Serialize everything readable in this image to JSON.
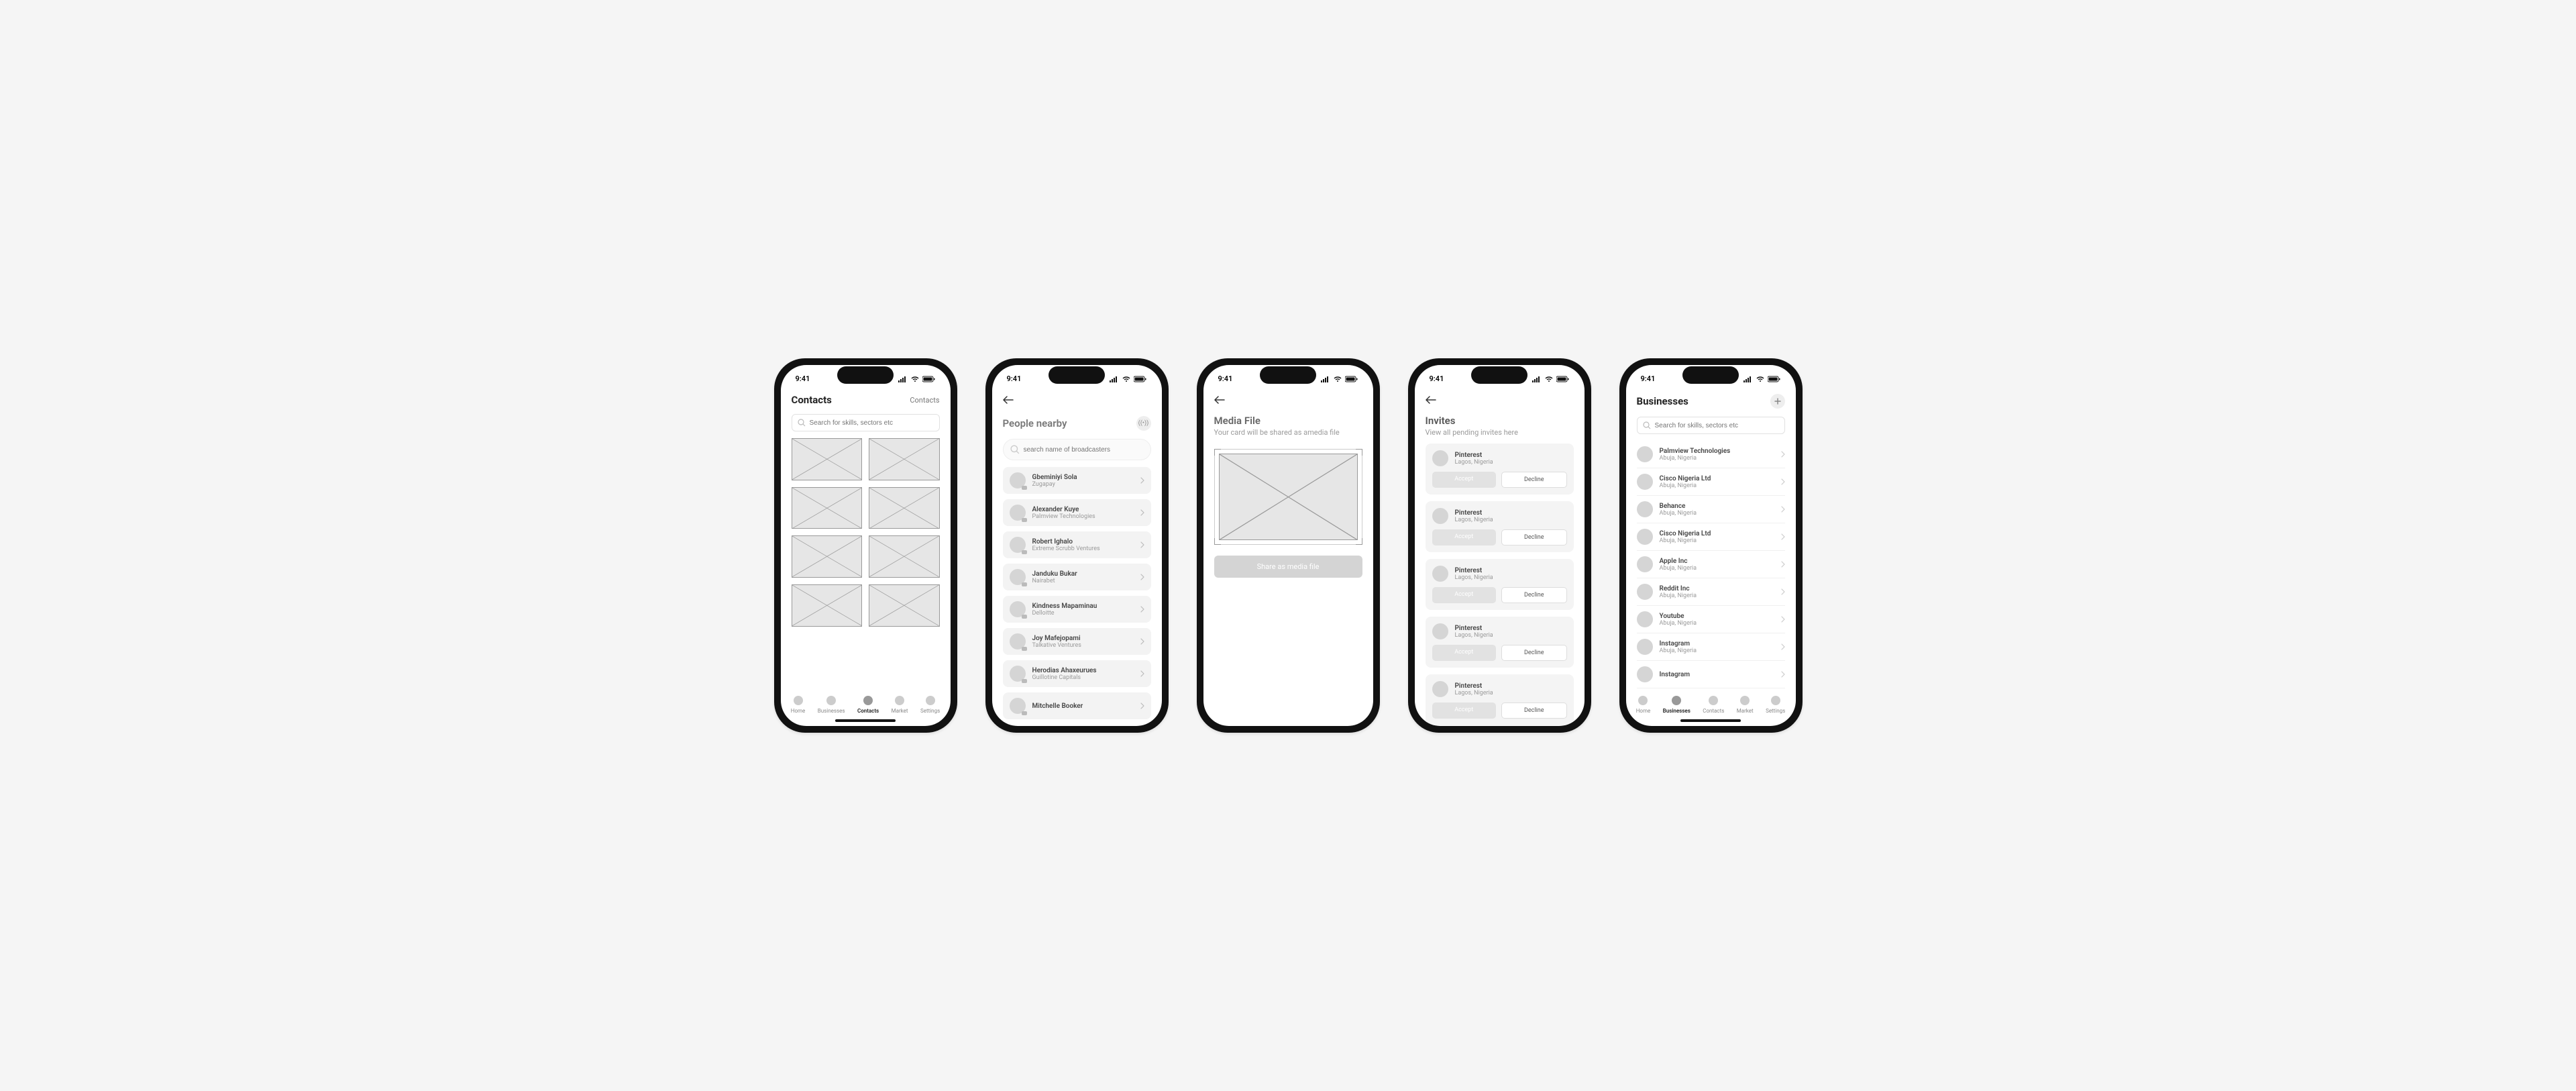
{
  "status_time": "9:41",
  "screen1": {
    "title": "Contacts",
    "action": "Contacts",
    "search_placeholder": "Search for skills, sectors etc",
    "tabs": [
      "Home",
      "Businesses",
      "Contacts",
      "Market",
      "Settings"
    ],
    "active_tab": 2
  },
  "screen2": {
    "title": "People nearby",
    "search_placeholder": "search name of broadcasters",
    "people": [
      {
        "name": "Gbeminiyi Sola",
        "sub": "Zugapay"
      },
      {
        "name": "Alexander Kuye",
        "sub": "Palmview Technologies"
      },
      {
        "name": "Robert Ighalo",
        "sub": "Extreme Scrubb Ventures"
      },
      {
        "name": "Janduku Bukar",
        "sub": "Nairabet"
      },
      {
        "name": "Kindness Mapaminau",
        "sub": "Delloitte"
      },
      {
        "name": "Joy Mafejopami",
        "sub": "Talkative Ventures"
      },
      {
        "name": "Herodias Ahaxeurues",
        "sub": "Guillotine Capitals"
      },
      {
        "name": "Mitchelle Booker",
        "sub": ""
      }
    ]
  },
  "screen3": {
    "title": "Media File",
    "subtitle": "Your card will be shared as amedia file",
    "button": "Share as media file"
  },
  "screen4": {
    "title": "Invites",
    "subtitle": "View all pending invites here",
    "accept": "Accept",
    "decline": "Decline",
    "invites": [
      {
        "name": "Pinterest",
        "sub": "Lagos, Nigeria"
      },
      {
        "name": "Pinterest",
        "sub": "Lagos, Nigeria"
      },
      {
        "name": "Pinterest",
        "sub": "Lagos, Nigeria"
      },
      {
        "name": "Pinterest",
        "sub": "Lagos, Nigeria"
      },
      {
        "name": "Pinterest",
        "sub": "Lagos, Nigeria"
      }
    ]
  },
  "screen5": {
    "title": "Businesses",
    "search_placeholder": "Search for skills, sectors etc",
    "tabs": [
      "Home",
      "Businesses",
      "Contacts",
      "Market",
      "Settings"
    ],
    "active_tab": 1,
    "list": [
      {
        "name": "Palmview Technologies",
        "sub": "Abuja, Nigeria"
      },
      {
        "name": "Cisco Nigeria Ltd",
        "sub": "Abuja, Nigeria"
      },
      {
        "name": "Behance",
        "sub": "Abuja, Nigeria"
      },
      {
        "name": "Cisco Nigeria Ltd",
        "sub": "Abuja, Nigeria"
      },
      {
        "name": "Apple Inc",
        "sub": "Abuja, Nigeria"
      },
      {
        "name": "Reddit Inc",
        "sub": "Abuja, Nigeria"
      },
      {
        "name": "Youtube",
        "sub": "Abuja, Nigeria"
      },
      {
        "name": "Instagram",
        "sub": "Abuja, Nigeria"
      },
      {
        "name": "Instagram",
        "sub": ""
      }
    ]
  }
}
